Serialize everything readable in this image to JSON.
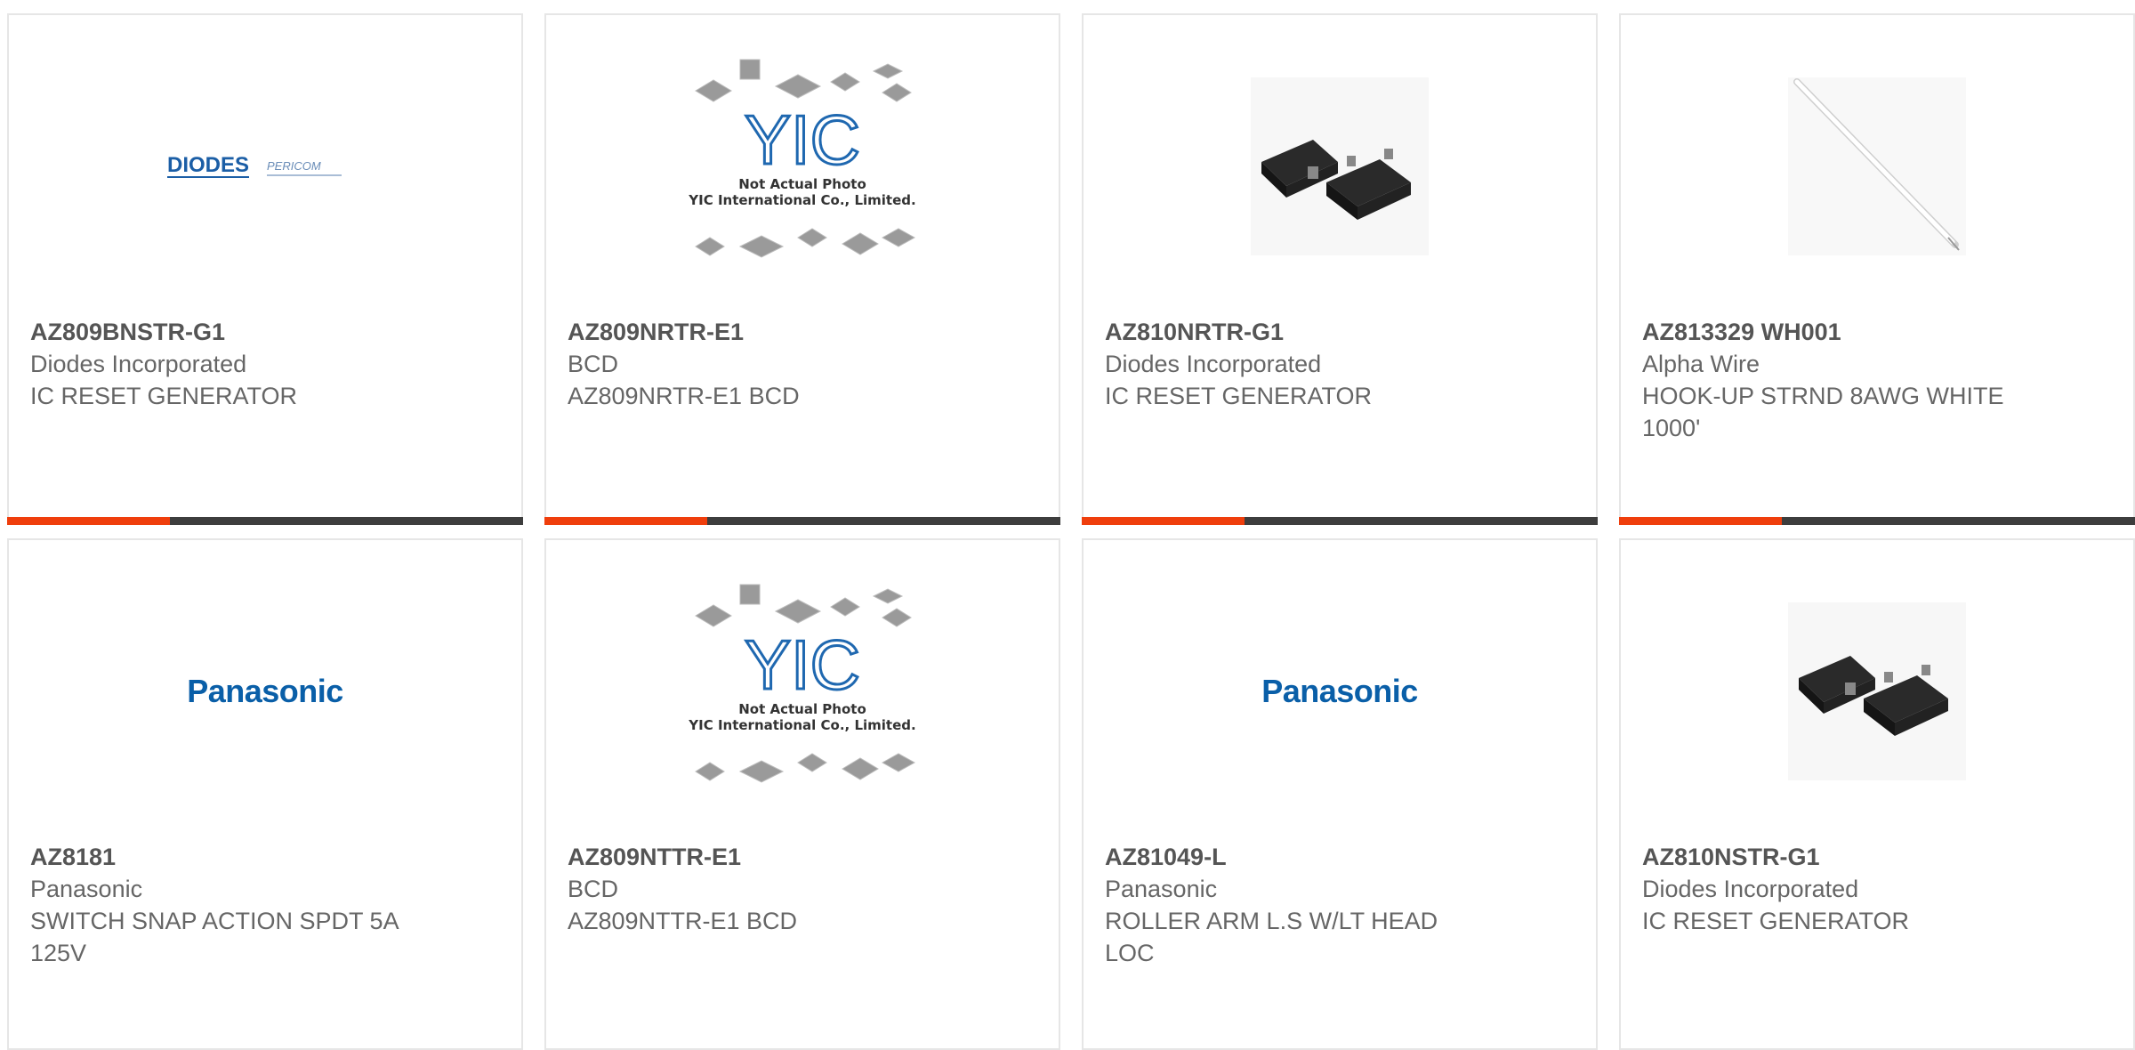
{
  "colors": {
    "accent": "#ef3e0c",
    "bar": "#3d3d3d",
    "text": "#666666",
    "panasonic_blue": "#0a5fa8",
    "diodes_blue": "#1b5ea6"
  },
  "products": [
    {
      "part_number": "AZ809BNSTR-G1",
      "manufacturer": "Diodes Incorporated",
      "description": "IC RESET GENERATOR",
      "image": "diodes-pericom-logo",
      "logo": {
        "primary": "DIODES",
        "secondary": "PERICOM"
      }
    },
    {
      "part_number": "AZ809NRTR-E1",
      "manufacturer": "BCD",
      "description": "AZ809NRTR-E1 BCD",
      "image": "yic-placeholder",
      "placeholder": {
        "brand": "YIC",
        "line1": "Not Actual Photo",
        "line2": "YIC International Co., Limited."
      }
    },
    {
      "part_number": "AZ810NRTR-G1",
      "manufacturer": "Diodes Incorporated",
      "description": "IC RESET GENERATOR",
      "image": "sot23-chip-photo"
    },
    {
      "part_number": "AZ813329 WH001",
      "manufacturer": "Alpha Wire",
      "description": "HOOK-UP STRND 8AWG WHITE 1000'",
      "image": "white-wire-photo"
    },
    {
      "part_number": "AZ8181",
      "manufacturer": "Panasonic",
      "description": "SWITCH SNAP ACTION SPDT 5A 125V",
      "image": "panasonic-logo",
      "logo": {
        "primary": "Panasonic"
      }
    },
    {
      "part_number": "AZ809NTTR-E1",
      "manufacturer": "BCD",
      "description": "AZ809NTTR-E1 BCD",
      "image": "yic-placeholder",
      "placeholder": {
        "brand": "YIC",
        "line1": "Not Actual Photo",
        "line2": "YIC International Co., Limited."
      }
    },
    {
      "part_number": "AZ81049-L",
      "manufacturer": "Panasonic",
      "description": "ROLLER ARM L.S W/LT HEAD LOC",
      "image": "panasonic-logo",
      "logo": {
        "primary": "Panasonic"
      }
    },
    {
      "part_number": "AZ810NSTR-G1",
      "manufacturer": "Diodes Incorporated",
      "description": "IC RESET GENERATOR",
      "image": "sot23-chip-photo"
    }
  ]
}
